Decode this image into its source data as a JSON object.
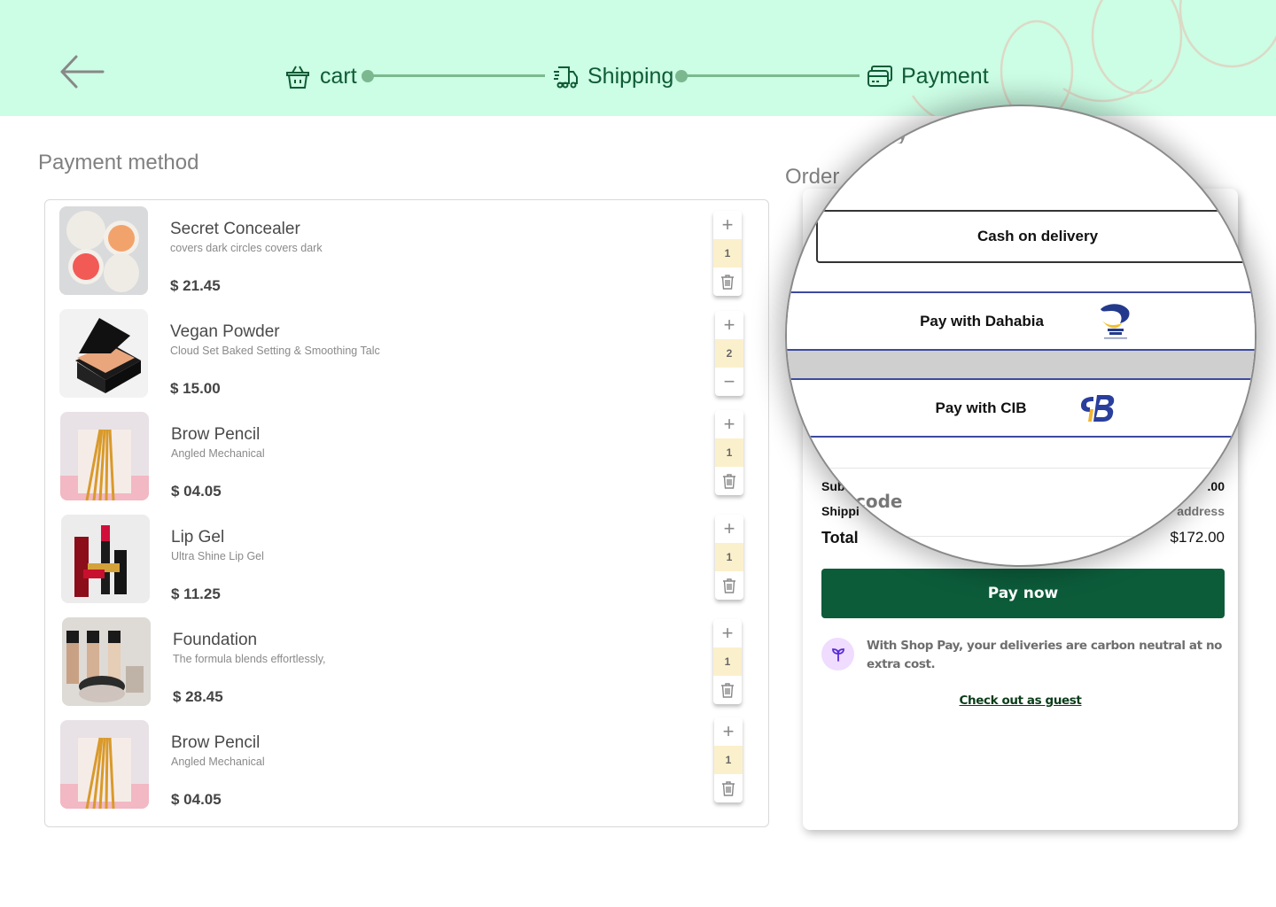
{
  "header": {
    "back_icon": "arrow-left-icon",
    "steps": [
      {
        "label": "cart",
        "icon": "basket-icon"
      },
      {
        "label": "Shipping",
        "icon": "truck-icon"
      },
      {
        "label": "Payment",
        "icon": "card-icon"
      }
    ]
  },
  "cart": {
    "title": "Payment method",
    "items": [
      {
        "name": "Secret Concealer",
        "desc": "covers dark circles covers dark",
        "price": "$ 21.45",
        "qty": "1",
        "lower_action": "delete"
      },
      {
        "name": "Vegan Powder",
        "desc": "Cloud Set Baked Setting & Smoothing Talc",
        "price": "$ 15.00",
        "qty": "2",
        "lower_action": "decrement"
      },
      {
        "name": "Brow Pencil",
        "desc": "Angled Mechanical",
        "price": "$ 04.05",
        "qty": "1",
        "lower_action": "delete"
      },
      {
        "name": "Lip Gel",
        "desc": "Ultra Shine Lip Gel",
        "price": "$ 11.25",
        "qty": "1",
        "lower_action": "delete"
      },
      {
        "name": "Foundation",
        "desc": "The formula blends effortlessly,",
        "price": "$ 28.45",
        "qty": "1",
        "lower_action": "delete"
      },
      {
        "name": "Brow Pencil",
        "desc": "Angled Mechanical",
        "price": "$ 04.05",
        "qty": "1",
        "lower_action": "delete"
      }
    ],
    "plus_symbol": "+",
    "minus_symbol": "−"
  },
  "summary": {
    "title": "Order summary",
    "title_visible": "Order",
    "subtotal_label": "Sub",
    "subtotal_value": ".00",
    "shipping_label": "Shippi",
    "shipping_value": "address",
    "total_label": "Total",
    "total_value": "$172.00",
    "pay_now": "Pay now",
    "shoppay_text": "With Shop Pay, your deliveries are carbon neutral at no extra cost.",
    "guest_link": "Check out as guest"
  },
  "magnifier": {
    "partial_heading": "y",
    "payment_options": [
      {
        "label": "Cash on delivery",
        "logo": null
      },
      {
        "label": "Pay with Dahabia",
        "logo": "dahabia-logo"
      },
      {
        "label": "Pay with CIB",
        "logo": "cib-logo"
      }
    ],
    "promo_label": "code"
  },
  "colors": {
    "header_bg": "#ccfde5",
    "brand_green": "#0e5c34",
    "pay_button": "#0c5c3a",
    "qty_bg": "#fbf0cc",
    "option_border": "#3c4aa0"
  }
}
